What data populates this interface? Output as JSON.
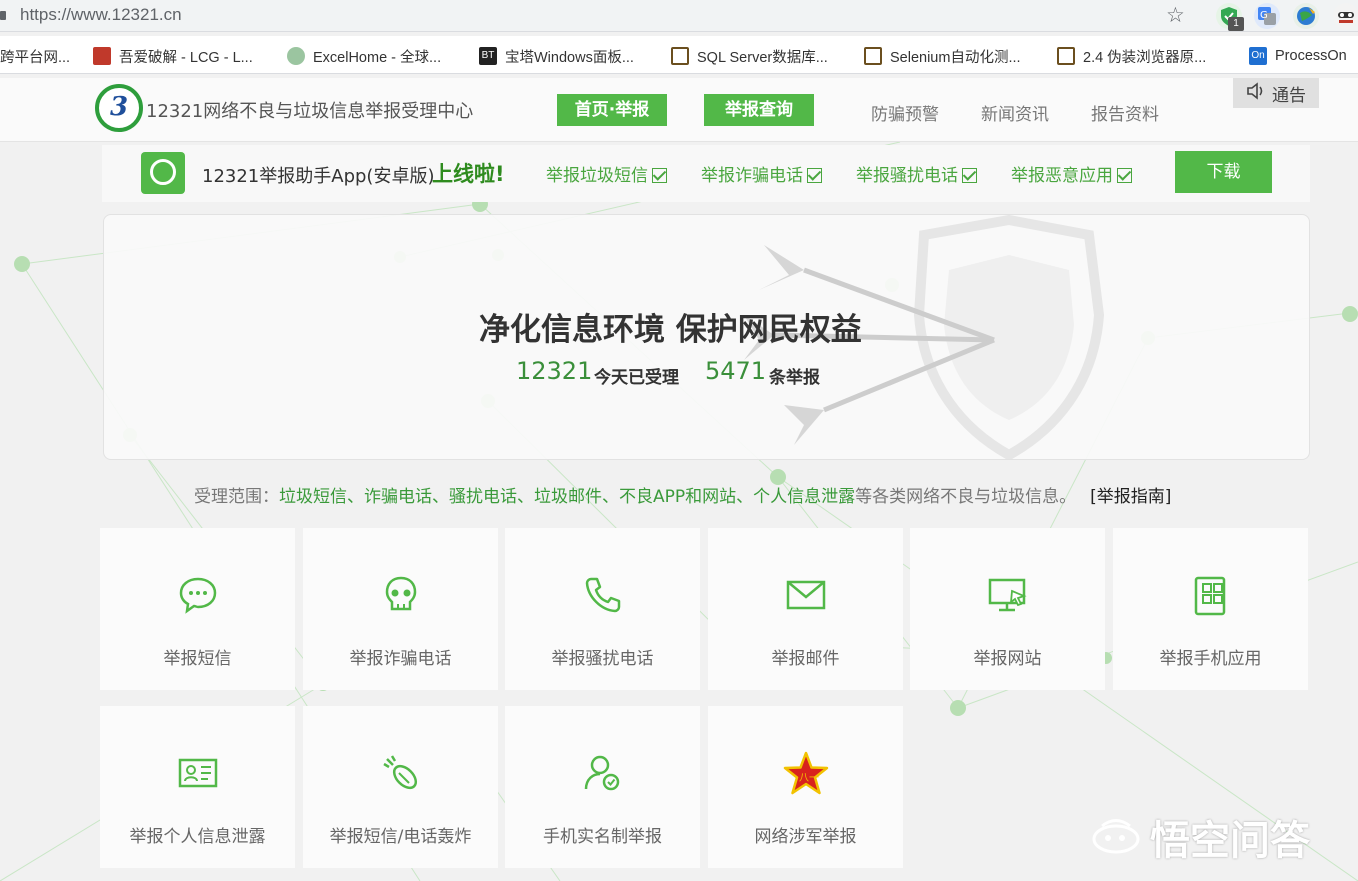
{
  "browser": {
    "url": "https://www.12321.cn",
    "ext_badge": "1",
    "bookmarks": [
      {
        "label": "跨平台网...",
        "icon": "globe-icon"
      },
      {
        "label": "吾爱破解 - LCG - L...",
        "icon": "52pojie-icon"
      },
      {
        "label": "ExcelHome - 全球...",
        "icon": "excelhome-icon"
      },
      {
        "label": "宝塔Windows面板...",
        "icon": "bt-icon"
      },
      {
        "label": "SQL Server数据库...",
        "icon": "v-icon"
      },
      {
        "label": "Selenium自动化测...",
        "icon": "v-icon"
      },
      {
        "label": "2.4 伪装浏览器原...",
        "icon": "v-icon"
      },
      {
        "label": "ProcessOn",
        "icon": "processon-icon"
      }
    ]
  },
  "header": {
    "logo_mark": "3",
    "site_title": "12321网络不良与垃圾信息举报受理中心",
    "nav": [
      "首页·举报",
      "举报查询",
      "防骗预警",
      "新闻资讯",
      "报告资料"
    ],
    "notice": "通告"
  },
  "app_banner": {
    "app_name": "12321举报助手App(安卓版)",
    "online": "上线啦!",
    "features": [
      "举报垃圾短信",
      "举报诈骗电话",
      "举报骚扰电话",
      "举报恶意应用"
    ],
    "download": "下载"
  },
  "hero": {
    "title": "净化信息环境 保护网民权益",
    "num1": "12321",
    "text1": "今天已受理",
    "num2": "5471",
    "text2": "条举报"
  },
  "scope": {
    "prefix": "受理范围：",
    "items": "垃圾短信、诈骗电话、骚扰电话、垃圾邮件、不良APP和网站、个人信息泄露",
    "suffix": "等各类网络不良与垃圾信息。",
    "guide": "[举报指南]"
  },
  "tiles": [
    {
      "label": "举报短信",
      "icon": "chat-bubble-icon"
    },
    {
      "label": "举报诈骗电话",
      "icon": "skull-icon"
    },
    {
      "label": "举报骚扰电话",
      "icon": "phone-icon"
    },
    {
      "label": "举报邮件",
      "icon": "mail-icon"
    },
    {
      "label": "举报网站",
      "icon": "monitor-icon"
    },
    {
      "label": "举报手机应用",
      "icon": "app-grid-icon"
    },
    {
      "label": "举报个人信息泄露",
      "icon": "id-card-icon"
    },
    {
      "label": "举报短信/电话轰炸",
      "icon": "bomb-icon"
    },
    {
      "label": "手机实名制举报",
      "icon": "user-verified-icon"
    },
    {
      "label": "网络涉军举报",
      "icon": "army-star-icon"
    }
  ],
  "watermark": "悟空问答",
  "colors": {
    "brand_green": "#52b848",
    "text_green": "#3a9a3a"
  }
}
